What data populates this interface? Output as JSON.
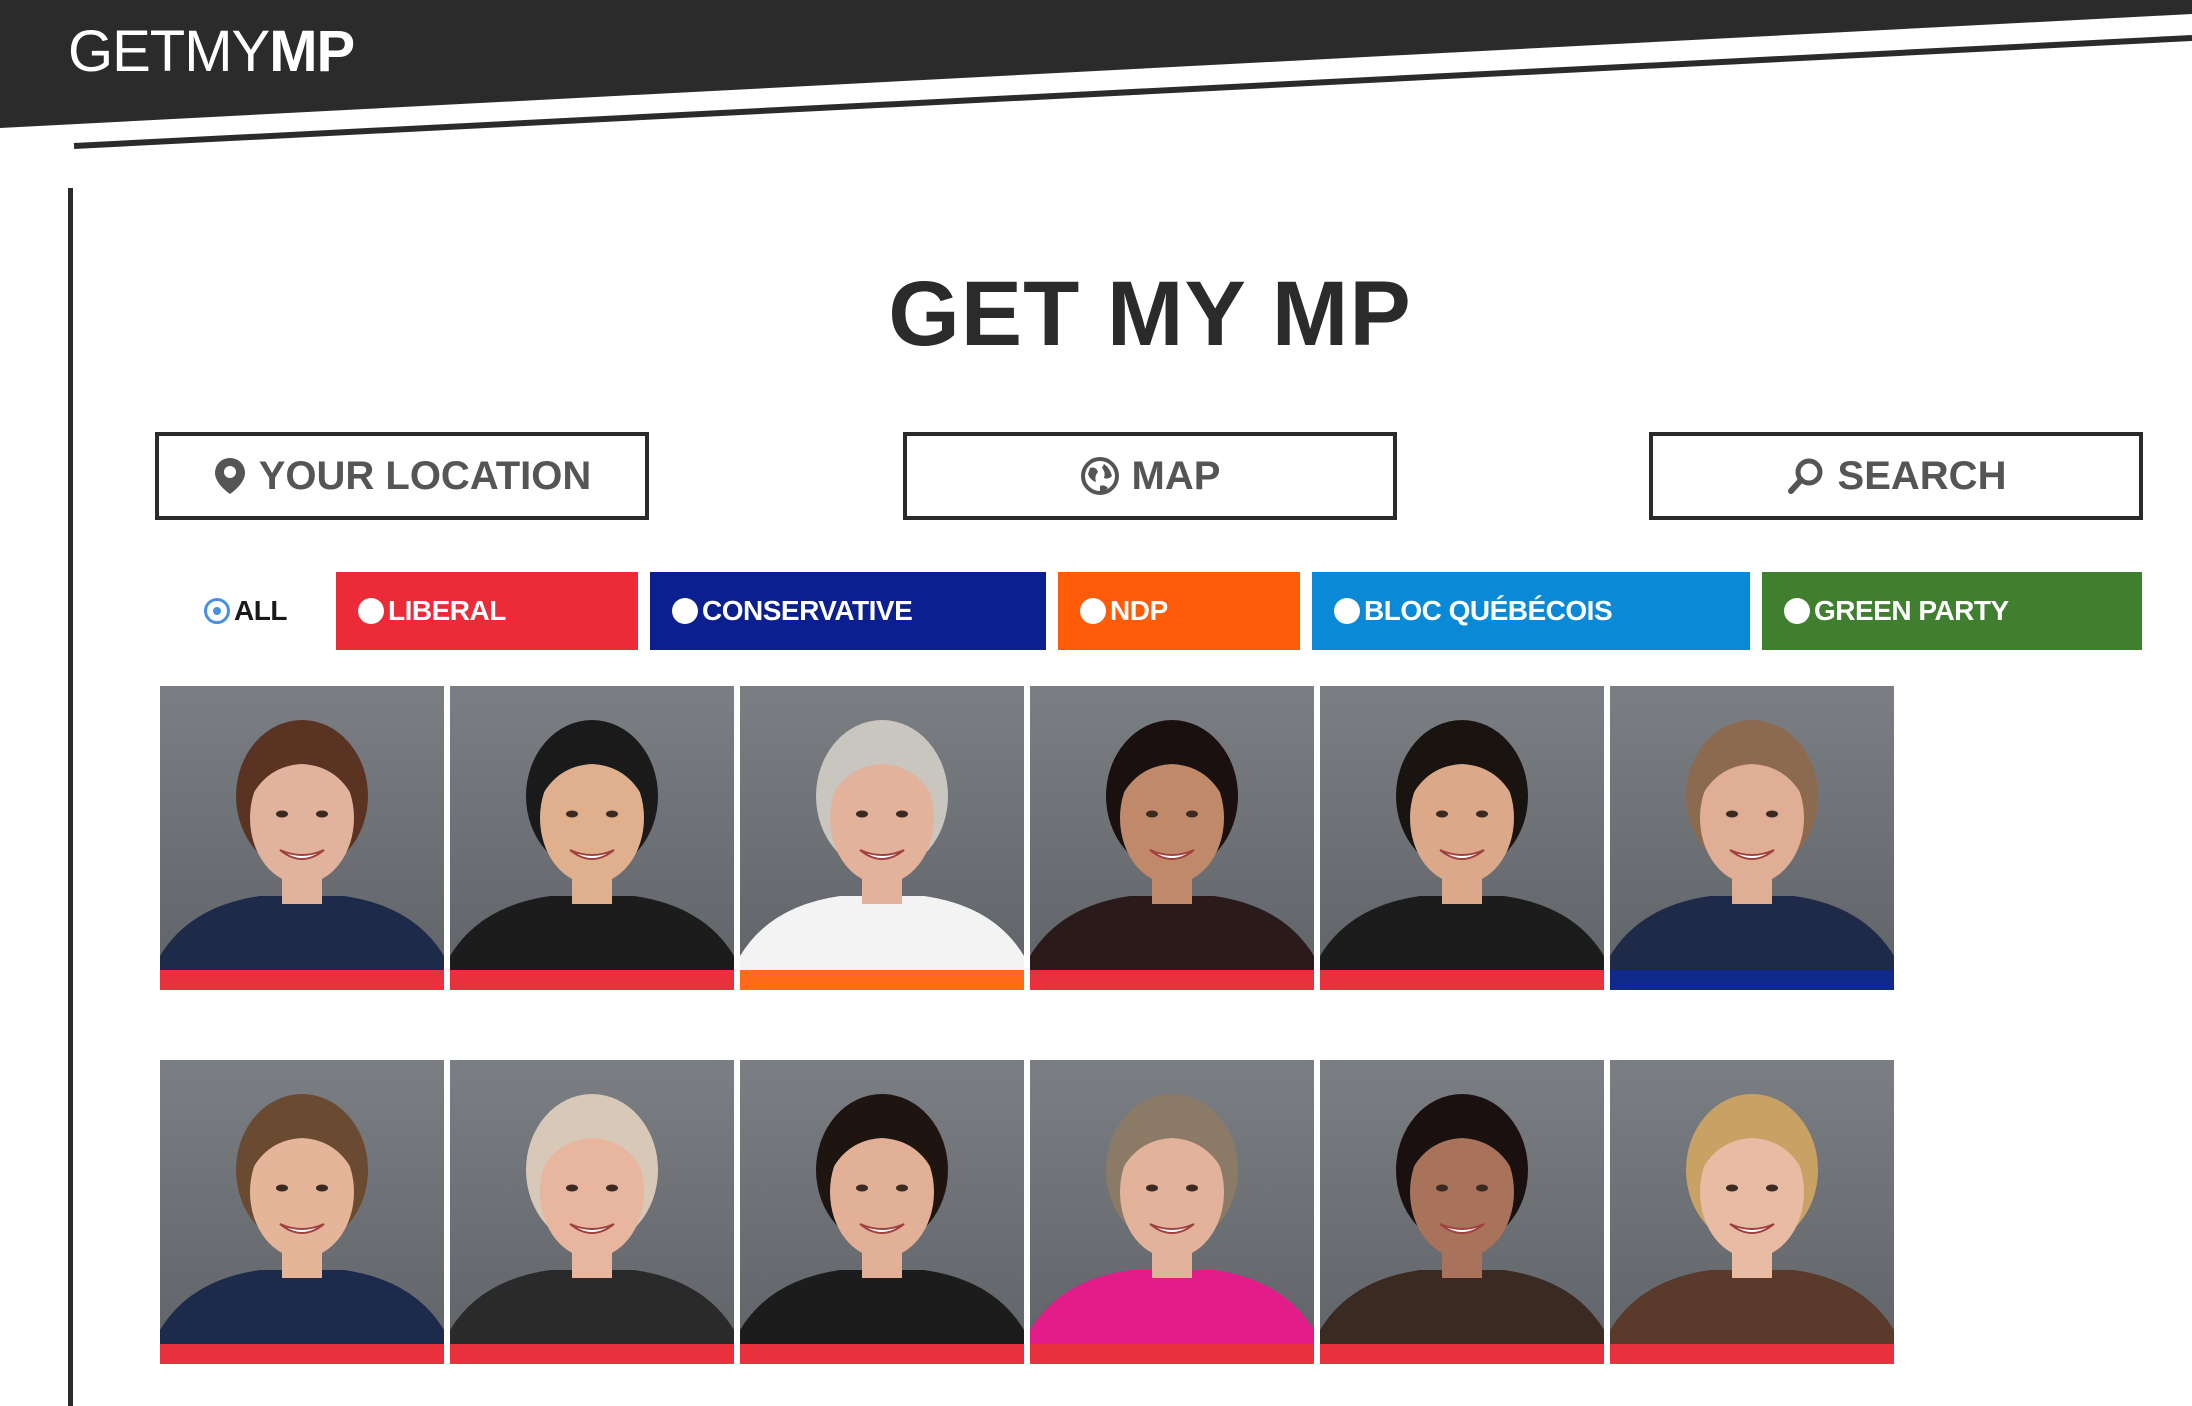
{
  "header": {
    "logo_light": "GETMY",
    "logo_bold": "MP"
  },
  "page_title": "GET MY MP",
  "buttons": [
    {
      "label": "YOUR LOCATION",
      "icon": "map-pin-icon"
    },
    {
      "label": "MAP",
      "icon": "globe-icon"
    },
    {
      "label": "SEARCH",
      "icon": "search-icon"
    }
  ],
  "filters": [
    {
      "label": "ALL",
      "selected": true,
      "color": "transparent"
    },
    {
      "label": "LIBERAL",
      "selected": false,
      "color": "#ec2b38"
    },
    {
      "label": "CONSERVATIVE",
      "selected": false,
      "color": "#0b1f8f"
    },
    {
      "label": "NDP",
      "selected": false,
      "color": "#ff5c0a"
    },
    {
      "label": "BLOC QUÉBÉCOIS",
      "selected": false,
      "color": "#0a8ad6"
    },
    {
      "label": "GREEN PARTY",
      "selected": false,
      "color": "#3f7f2f"
    }
  ],
  "colors": {
    "liberal": "#e8313c",
    "conservative": "#102a8c",
    "ndp": "#ff6a1a",
    "header_bg": "#2b2b2b"
  },
  "mps": [
    {
      "party": "liberal",
      "hair": "#5a3322",
      "skin": "#e2b39c",
      "clothing": "#1d2a4a"
    },
    {
      "party": "liberal",
      "hair": "#1a1a1a",
      "skin": "#e0b08e",
      "clothing": "#1c1c1c"
    },
    {
      "party": "ndp",
      "hair": "#c9c6c0",
      "skin": "#e2b29b",
      "clothing": "#f3f3f3"
    },
    {
      "party": "liberal",
      "hair": "#1a1010",
      "skin": "#c08a6a",
      "clothing": "#2a1a1a"
    },
    {
      "party": "liberal",
      "hair": "#1a1410",
      "skin": "#dba88a",
      "clothing": "#1c1c1c"
    },
    {
      "party": "conservative",
      "hair": "#8c6a50",
      "skin": "#e0ae94",
      "clothing": "#1e2a48"
    },
    {
      "party": "liberal",
      "hair": "#6a4a30",
      "skin": "#e5b59a",
      "clothing": "#1c2a4c"
    },
    {
      "party": "liberal",
      "hair": "#d8c8b8",
      "skin": "#e8b69e",
      "clothing": "#2a2a2a"
    },
    {
      "party": "liberal",
      "hair": "#1e1510",
      "skin": "#e2b096",
      "clothing": "#1c1c1c"
    },
    {
      "party": "liberal",
      "hair": "#8a7a66",
      "skin": "#e3b29a",
      "clothing": "#e21d8a"
    },
    {
      "party": "liberal",
      "hair": "#1a1010",
      "skin": "#a8735a",
      "clothing": "#3a2a22"
    },
    {
      "party": "liberal",
      "hair": "#c8a264",
      "skin": "#e8bca2",
      "clothing": "#5a3a2a"
    }
  ]
}
